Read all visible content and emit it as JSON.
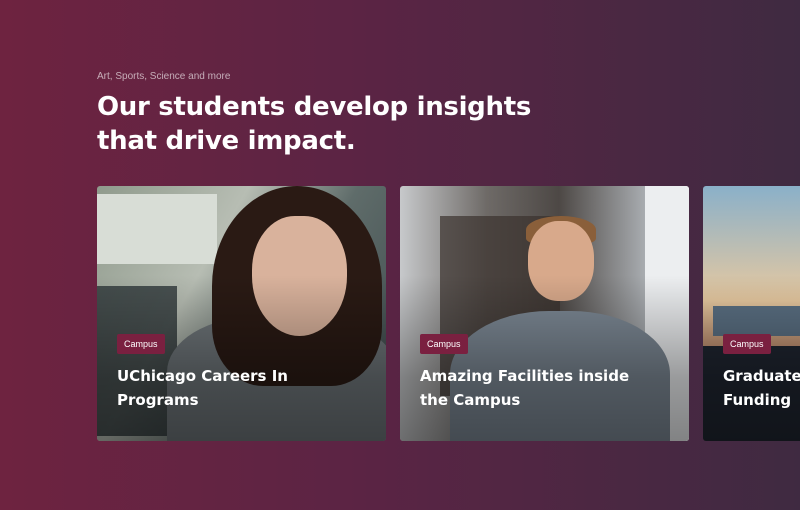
{
  "section": {
    "eyebrow": "Art, Sports, Science and more",
    "heading_line1": "Our students develop insights",
    "heading_line2": "that drive impact."
  },
  "cards": [
    {
      "tag": "Campus",
      "title_line1": "UChicago Careers In",
      "title_line2": "Programs"
    },
    {
      "tag": "Campus",
      "title_line1": "Amazing Facilities inside",
      "title_line2": "the Campus"
    },
    {
      "tag": "Campus",
      "title_line1": "Graduate",
      "title_line2": "Funding"
    }
  ],
  "colors": {
    "background_left": "#6e2340",
    "background_right": "#3f2a41",
    "tag_bg": "#7a2040",
    "text": "#ffffff"
  }
}
